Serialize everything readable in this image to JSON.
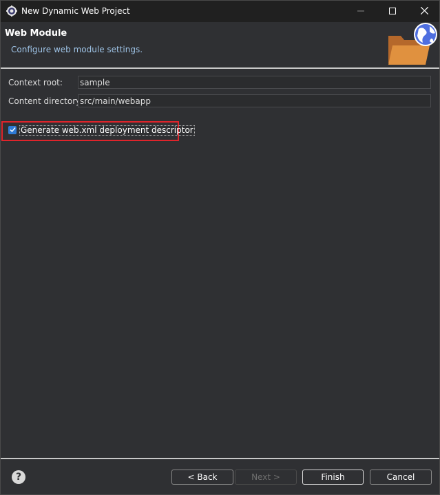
{
  "window": {
    "title": "New Dynamic Web Project"
  },
  "header": {
    "title": "Web Module",
    "description": "Configure web module settings."
  },
  "form": {
    "context_root_label": "Context root:",
    "context_root_value": "sample",
    "content_dir_label": "Content directory:",
    "content_dir_value": "src/main/webapp",
    "generate_xml_label": "Generate web.xml deployment descriptor",
    "generate_xml_checked": true
  },
  "footer": {
    "help_icon": "?",
    "back_label": "< Back",
    "next_label": "Next >",
    "finish_label": "Finish",
    "cancel_label": "Cancel"
  },
  "colors": {
    "accent_checkbox": "#2f7bd6",
    "highlight": "#e0242b",
    "folder": "#d68a3c",
    "globe": "#4f6fe0"
  },
  "icons": {
    "app": "eclipse-gear-icon",
    "header": "web-module-folder-globe-icon",
    "help": "help-icon",
    "check": "check-icon"
  }
}
